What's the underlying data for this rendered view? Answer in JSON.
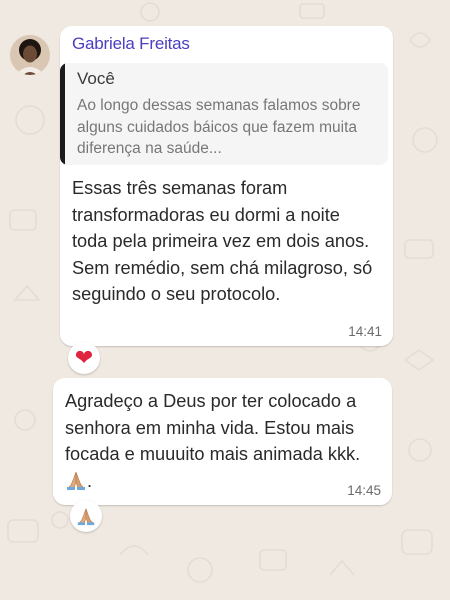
{
  "chat": {
    "messages": [
      {
        "sender": "Gabriela Freitas",
        "quote": {
          "author": "Você",
          "text": "Ao longo dessas semanas falamos sobre alguns cuidados báicos que fazem muita diferença na saúde..."
        },
        "text": "Essas três semanas foram transformadoras eu dormi a noite toda pela primeira vez em dois anos. Sem remédio, sem chá milagroso, só seguindo o seu protocolo.",
        "time": "14:41",
        "reaction": "❤"
      },
      {
        "text": "Agradeço a Deus por ter colocado a senhora em minha vida. Estou mais focada e muuuito mais animada kkk.",
        "text_suffix": ".",
        "time": "14:45",
        "reaction": "🙏"
      }
    ]
  },
  "colors": {
    "sender_name": "#4a3ec1",
    "wallpaper": "#efe9e1",
    "bubble": "#ffffff",
    "heart": "#e0243f"
  },
  "icons": [
    "avatar",
    "heart-reaction-icon",
    "praying-hands-icon"
  ]
}
